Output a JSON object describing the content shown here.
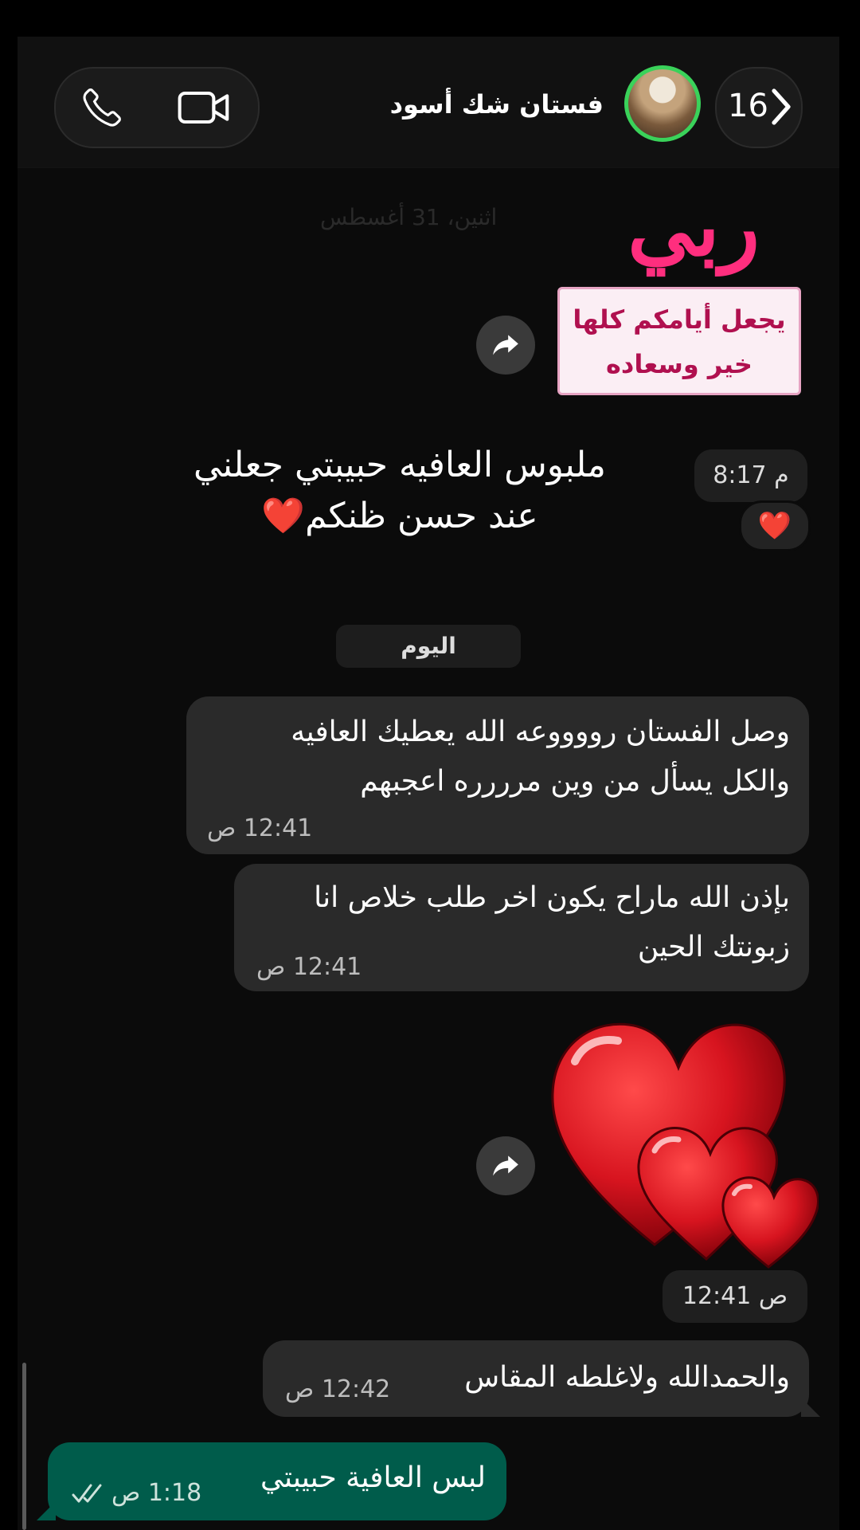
{
  "header": {
    "contact_name": "فستان شك أسود",
    "back_count": "16",
    "icons": {
      "back": "chevron-icon",
      "video": "video-camera-icon",
      "call": "phone-icon"
    }
  },
  "stickers": {
    "rabbi": "ربي",
    "card_line1": "يجعل أيامكم كلها",
    "card_line2": "خير وسعاده"
  },
  "faded_date": "اثنين، 31 أغسطس",
  "caption": {
    "line1": "ملبوس العافيه حبيبتي جعلني",
    "line2": "عند حسن ظنكم❤️",
    "time": "8:17 م",
    "reaction": "❤️"
  },
  "today_label": "اليوم",
  "messages": [
    {
      "line1": "وصل الفستان رووووعه الله يعطيك العافيه",
      "line2": "والكل يسأل من وين مرررره اعجبهم",
      "time": "12:41 ص"
    },
    {
      "line1": "بإذن الله ماراح يكون اخر طلب خلاص انا",
      "line2": "زبونتك الحين",
      "time": "12:41 ص"
    },
    {
      "time": "12:41 ص"
    },
    {
      "line1": "والحمدالله ولاغلطه المقاس",
      "time": "12:42 ص"
    }
  ],
  "outgoing": {
    "text": "لبس العافية حبيبتي",
    "time": "1:18 ص",
    "status": "read-checks-icon"
  },
  "colors": {
    "accent_green": "#005c4b",
    "avatar_ring": "#3ad25a",
    "sticker_pink": "#ff2e7e",
    "heart_red": "#d7141f"
  }
}
